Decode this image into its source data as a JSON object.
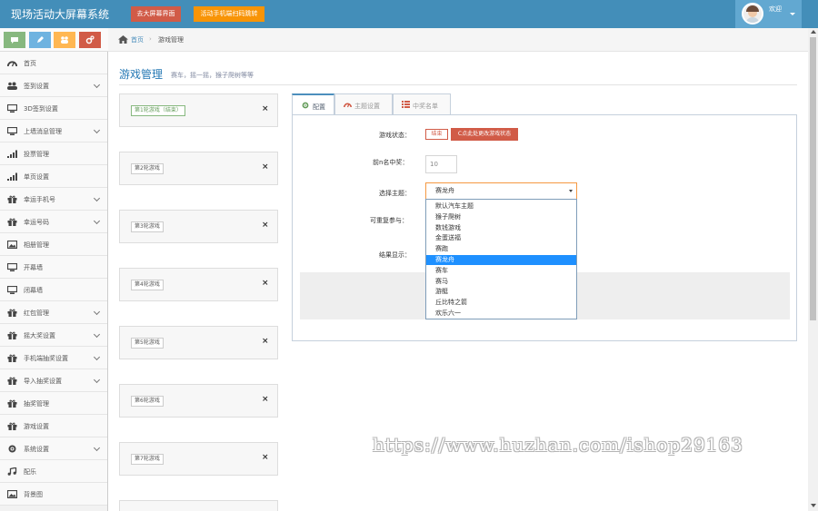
{
  "header": {
    "brand": "现场活动大屏幕系统",
    "btn_big_screen": "去大屏幕界面",
    "btn_phone": "活动手机端扫码跳转",
    "welcome": "欢迎"
  },
  "breadcrumb": {
    "home": "首页",
    "separator": "›",
    "current": "游戏管理"
  },
  "sidebar": {
    "items": [
      {
        "label": "首页",
        "icon": "dashboard-icon",
        "chevron": false
      },
      {
        "label": "签到设置",
        "icon": "users-icon",
        "chevron": true
      },
      {
        "label": "3D签到设置",
        "icon": "desktop-icon",
        "chevron": false
      },
      {
        "label": "上墙消息管理",
        "icon": "desktop-icon",
        "chevron": true
      },
      {
        "label": "投票管理",
        "icon": "signal-icon",
        "chevron": false
      },
      {
        "label": "单页设置",
        "icon": "signal-icon",
        "chevron": false
      },
      {
        "label": "幸运手机号",
        "icon": "gift-icon",
        "chevron": true
      },
      {
        "label": "幸运号码",
        "icon": "gift-icon",
        "chevron": true
      },
      {
        "label": "相册管理",
        "icon": "picture-icon",
        "chevron": false
      },
      {
        "label": "开幕墙",
        "icon": "desktop-icon",
        "chevron": false
      },
      {
        "label": "闭幕墙",
        "icon": "desktop-icon",
        "chevron": false
      },
      {
        "label": "红包管理",
        "icon": "gift-icon",
        "chevron": true
      },
      {
        "label": "摇大奖设置",
        "icon": "gift-icon",
        "chevron": true
      },
      {
        "label": "手机端抽奖设置",
        "icon": "gift-icon",
        "chevron": true
      },
      {
        "label": "导入抽奖设置",
        "icon": "gift-icon",
        "chevron": true
      },
      {
        "label": "抽奖管理",
        "icon": "gift-icon",
        "chevron": false
      },
      {
        "label": "游戏设置",
        "icon": "gift-icon",
        "chevron": false
      },
      {
        "label": "系统设置",
        "icon": "gear-icon",
        "chevron": true
      },
      {
        "label": "配乐",
        "icon": "music-icon",
        "chevron": false
      },
      {
        "label": "背景图",
        "icon": "picture-icon",
        "chevron": false
      }
    ]
  },
  "page": {
    "title": "游戏管理",
    "subtitle": "赛车，摇一摇，猴子爬树等等"
  },
  "games": [
    {
      "label": "第1轮游戏（结束）",
      "done": true
    },
    {
      "label": "第2轮游戏",
      "done": false
    },
    {
      "label": "第3轮游戏",
      "done": false
    },
    {
      "label": "第4轮游戏",
      "done": false
    },
    {
      "label": "第5轮游戏",
      "done": false
    },
    {
      "label": "第6轮游戏",
      "done": false
    },
    {
      "label": "第7轮游戏",
      "done": false
    }
  ],
  "tabs": [
    {
      "label": "配置",
      "icon": "gear-icon",
      "active": true
    },
    {
      "label": "主题设置",
      "icon": "dashboard-icon",
      "active": false
    },
    {
      "label": "中奖名单",
      "icon": "list-icon",
      "active": false
    }
  ],
  "form": {
    "status_label": "游戏状态：",
    "status_value": "结束",
    "status_button": "点此处更改游戏状态",
    "winners_label": "前n名中奖：",
    "winners_value": "10",
    "theme_label": "选择主题：",
    "theme_selected": "赛龙舟",
    "repeat_label": "可重复参与：",
    "result_label": "结果显示："
  },
  "theme_options": [
    "默认汽车主题",
    "猴子爬树",
    "数钱游戏",
    "金蛋送福",
    "赛跑",
    "赛龙舟",
    "赛车",
    "赛马",
    "游艇",
    "丘比特之箭",
    "欢乐六一"
  ],
  "theme_selected_index": 5,
  "watermark": "https://www.huzhan.com/ishop29163",
  "colors": {
    "topbar": "#438eb9",
    "accent": "#2679b5",
    "danger": "#d15b47",
    "warning": "#f89406",
    "selection": "#1e90ff"
  }
}
